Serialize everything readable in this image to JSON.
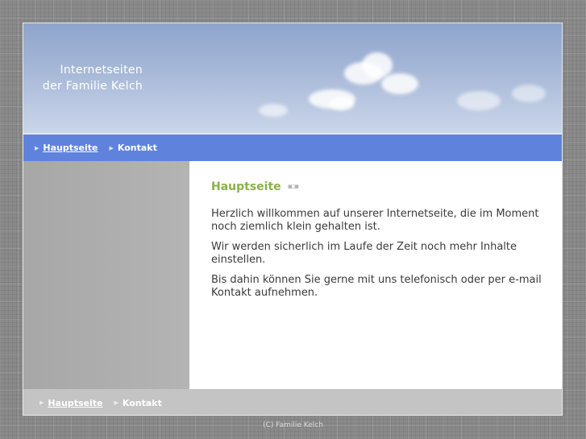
{
  "header": {
    "title_line1": "Internetseiten",
    "title_line2": "der Familie Kelch"
  },
  "topnav": {
    "items": [
      {
        "label": "Hauptseite",
        "active": true
      },
      {
        "label": "Kontakt",
        "active": false
      }
    ]
  },
  "content": {
    "heading": "Hauptseite",
    "paragraphs": [
      "Herzlich willkommen auf unserer Internetseite, die im Moment noch ziemlich klein gehalten ist.",
      "Wir werden sicherlich im Laufe der Zeit noch mehr Inhalte einstellen.",
      "Bis dahin können Sie gerne mit uns telefonisch oder per e-mail Kontakt aufnehmen."
    ]
  },
  "footnav": {
    "items": [
      {
        "label": "Hauptseite",
        "active": true
      },
      {
        "label": "Kontakt",
        "active": false
      }
    ]
  },
  "footer": {
    "copyright": "(C) Familie Kelch"
  },
  "icons": {
    "nav_bullet": "triangle-right-icon",
    "heading_decoration": "dots-icon"
  },
  "colors": {
    "nav_bar": "#5f83dd",
    "heading": "#8ab04a",
    "footer_bar": "#c4c4c4"
  }
}
